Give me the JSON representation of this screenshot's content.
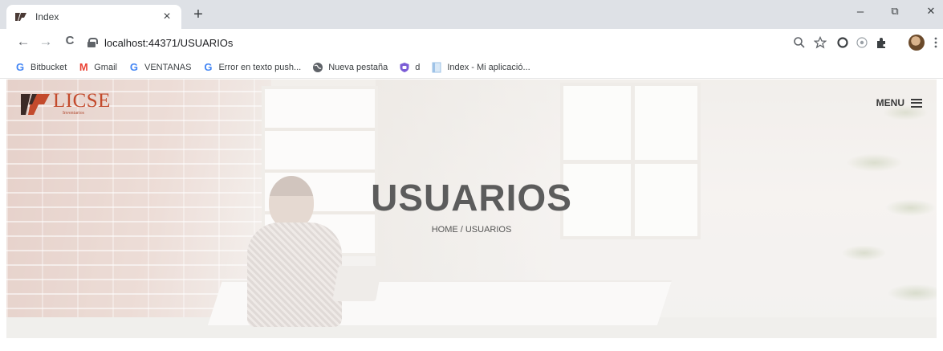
{
  "browser": {
    "tab": {
      "title": "Index",
      "close_icon": "×"
    },
    "new_tab_icon": "+",
    "window_controls": {
      "minimize": "–",
      "restore": "⧉",
      "close": "✕"
    },
    "nav": {
      "back": "←",
      "forward": "→",
      "reload": "C"
    },
    "url": "localhost:44371/USUARIOs",
    "toolbar_icons": [
      "zoom-icon",
      "star-icon",
      "extension-icon",
      "extension-icon",
      "puzzle-icon",
      "avatar",
      "more-icon"
    ]
  },
  "bookmarks": [
    {
      "label": "Bitbucket",
      "icon": "G",
      "color": "#4285f4"
    },
    {
      "label": "Gmail",
      "icon": "M",
      "color": "#ea4335"
    },
    {
      "label": "VENTANAS",
      "icon": "G",
      "color": "#4285f4"
    },
    {
      "label": "Error en texto push...",
      "icon": "G",
      "color": "#4285f4"
    },
    {
      "label": "Nueva pestaña",
      "icon": "globe",
      "color": "#5f6368"
    },
    {
      "label": "d",
      "icon": "shield",
      "color": "#7b5cd6"
    },
    {
      "label": "Index - Mi aplicació...",
      "icon": "page",
      "color": "#9fc3e7"
    }
  ],
  "site": {
    "logo": {
      "name": "LICSE",
      "subtitle": "Inventarios"
    },
    "menu_label": "MENU",
    "page_title": "USUARIOS",
    "breadcrumb": "HOME / USUARIOS"
  },
  "colors": {
    "brand": "#c34a2c",
    "title": "#5c5c5c"
  }
}
